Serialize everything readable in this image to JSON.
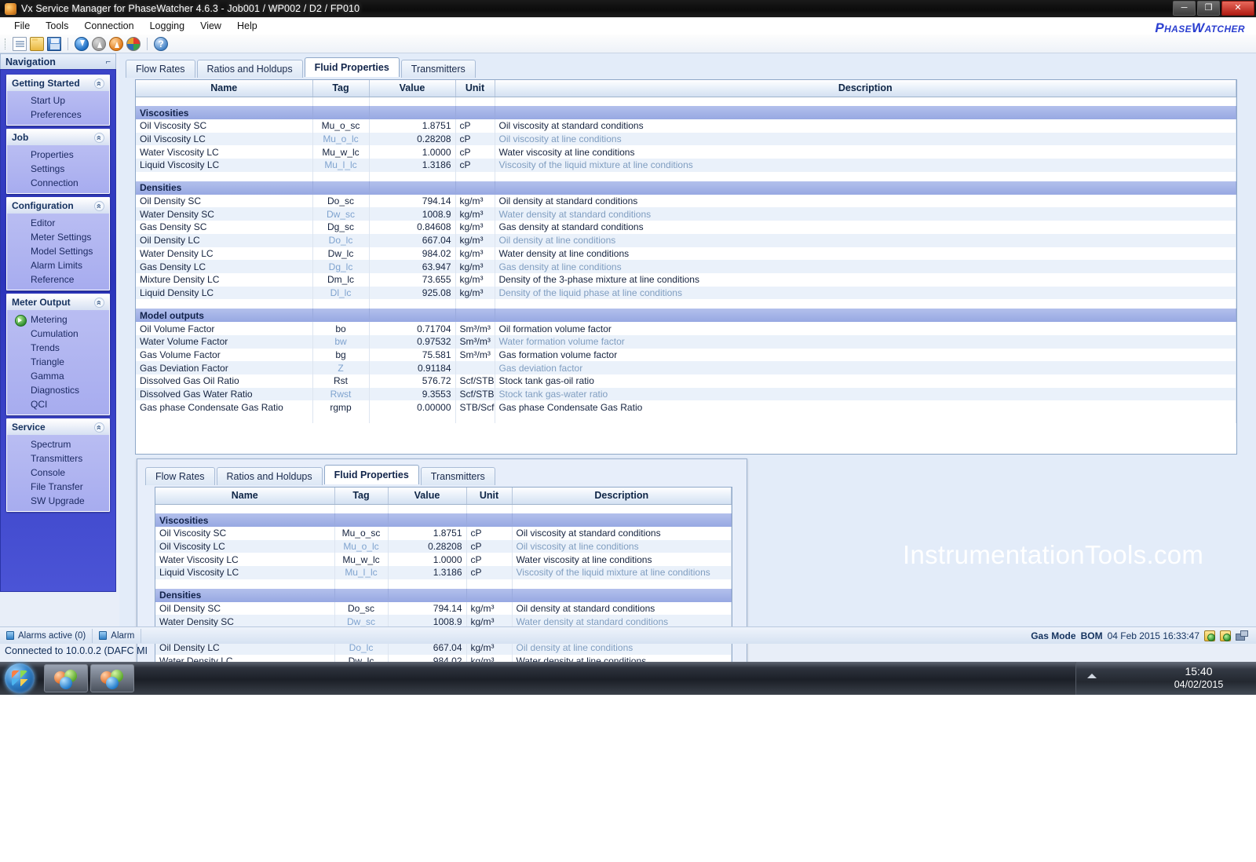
{
  "window": {
    "title": "Vx Service Manager for PhaseWatcher 4.6.3 - Job001 / WP002 / D2 / FP010",
    "icon": "app-icon",
    "minimize": "─",
    "maximize": "❐",
    "close": "✕",
    "brand": "PhaseWatcher"
  },
  "menu": {
    "items": [
      "File",
      "Tools",
      "Connection",
      "Logging",
      "View",
      "Help"
    ]
  },
  "toolbar": {
    "icons": [
      {
        "name": "new-document-icon",
        "cls": "ic-doc"
      },
      {
        "name": "open-folder-icon",
        "cls": "ic-folder"
      },
      {
        "name": "save-icon",
        "cls": "ic-save"
      },
      {
        "name": "download-icon",
        "cls": "ic-dl"
      },
      {
        "name": "upload-disabled-icon",
        "cls": "ic-ul1"
      },
      {
        "name": "upload-icon",
        "cls": "ic-ul2"
      },
      {
        "name": "refresh-icon",
        "cls": "ic-refresh"
      },
      {
        "name": "help-icon",
        "cls": "ic-help",
        "glyph": "?"
      }
    ]
  },
  "navigation": {
    "title": "Navigation",
    "pin_icon": "pin-icon",
    "collapse_icon": "chevron-up-icon",
    "groups": [
      {
        "title": "Getting Started",
        "items": [
          {
            "label": "Start Up"
          },
          {
            "label": "Preferences"
          }
        ]
      },
      {
        "title": "Job",
        "items": [
          {
            "label": "Properties"
          },
          {
            "label": "Settings"
          },
          {
            "label": "Connection"
          }
        ]
      },
      {
        "title": "Configuration",
        "items": [
          {
            "label": "Editor"
          },
          {
            "label": "Meter Settings"
          },
          {
            "label": "Model Settings"
          },
          {
            "label": "Alarm Limits"
          },
          {
            "label": "Reference"
          }
        ]
      },
      {
        "title": "Meter Output",
        "items": [
          {
            "label": "Metering",
            "active": true
          },
          {
            "label": "Cumulation"
          },
          {
            "label": "Trends"
          },
          {
            "label": "Triangle"
          },
          {
            "label": "Gamma"
          },
          {
            "label": "Diagnostics"
          },
          {
            "label": "QCI"
          }
        ]
      },
      {
        "title": "Service",
        "items": [
          {
            "label": "Spectrum"
          },
          {
            "label": "Transmitters"
          },
          {
            "label": "Console"
          },
          {
            "label": "File Transfer"
          },
          {
            "label": "SW Upgrade"
          }
        ]
      }
    ]
  },
  "tabs": {
    "items": [
      "Flow Rates",
      "Ratios and Holdups",
      "Fluid Properties",
      "Transmitters"
    ],
    "selected": "Fluid Properties"
  },
  "table": {
    "headers": [
      "Name",
      "Tag",
      "Value",
      "Unit",
      "Description"
    ],
    "rows": [
      {
        "type": "blank"
      },
      {
        "type": "section",
        "name": "Viscosities"
      },
      {
        "type": "data",
        "name": "Oil Viscosity SC",
        "tag": "Mu_o_sc",
        "value": "1.8751",
        "unit": "cP",
        "desc": "Oil viscosity at standard conditions"
      },
      {
        "type": "data",
        "name": "Oil Viscosity LC",
        "tag": "Mu_o_lc",
        "value": "0.28208",
        "unit": "cP",
        "desc": "Oil viscosity at line conditions"
      },
      {
        "type": "data",
        "name": "Water Viscosity LC",
        "tag": "Mu_w_lc",
        "value": "1.0000",
        "unit": "cP",
        "desc": "Water viscosity at line conditions"
      },
      {
        "type": "data",
        "name": "Liquid Viscosity LC",
        "tag": "Mu_l_lc",
        "value": "1.3186",
        "unit": "cP",
        "desc": "Viscosity of the liquid mixture at line conditions"
      },
      {
        "type": "blank"
      },
      {
        "type": "section",
        "name": "Densities"
      },
      {
        "type": "data",
        "name": "Oil Density SC",
        "tag": "Do_sc",
        "value": "794.14",
        "unit": "kg/m³",
        "desc": "Oil density at standard conditions"
      },
      {
        "type": "data",
        "name": "Water Density SC",
        "tag": "Dw_sc",
        "value": "1008.9",
        "unit": "kg/m³",
        "desc": "Water density at standard conditions"
      },
      {
        "type": "data",
        "name": "Gas Density SC",
        "tag": "Dg_sc",
        "value": "0.84608",
        "unit": "kg/m³",
        "desc": "Gas density at standard conditions"
      },
      {
        "type": "data",
        "name": "Oil Density LC",
        "tag": "Do_lc",
        "value": "667.04",
        "unit": "kg/m³",
        "desc": "Oil density at line conditions"
      },
      {
        "type": "data",
        "name": "Water Density LC",
        "tag": "Dw_lc",
        "value": "984.02",
        "unit": "kg/m³",
        "desc": "Water density at line conditions"
      },
      {
        "type": "data",
        "name": "Gas Density LC",
        "tag": "Dg_lc",
        "value": "63.947",
        "unit": "kg/m³",
        "desc": "Gas density at line conditions"
      },
      {
        "type": "data",
        "name": "Mixture Density LC",
        "tag": "Dm_lc",
        "value": "73.655",
        "unit": "kg/m³",
        "desc": "Density of the 3-phase mixture at line conditions"
      },
      {
        "type": "data",
        "name": "Liquid Density LC",
        "tag": "Dl_lc",
        "value": "925.08",
        "unit": "kg/m³",
        "desc": "Density of the liquid phase at line conditions"
      },
      {
        "type": "blank"
      },
      {
        "type": "section",
        "name": "Model outputs"
      },
      {
        "type": "data",
        "name": "Oil Volume Factor",
        "tag": "bo",
        "value": "0.71704",
        "unit": "Sm³/m³",
        "desc": "Oil formation volume factor"
      },
      {
        "type": "data",
        "name": "Water Volume Factor",
        "tag": "bw",
        "value": "0.97532",
        "unit": "Sm³/m³",
        "desc": "Water formation volume factor"
      },
      {
        "type": "data",
        "name": "Gas Volume Factor",
        "tag": "bg",
        "value": "75.581",
        "unit": "Sm³/m³",
        "desc": "Gas formation volume factor"
      },
      {
        "type": "data",
        "name": "Gas Deviation Factor",
        "tag": "Z",
        "value": "0.91184",
        "unit": "",
        "desc": "Gas deviation factor"
      },
      {
        "type": "data",
        "name": "Dissolved Gas Oil Ratio",
        "tag": "Rst",
        "value": "576.72",
        "unit": "Scf/STB",
        "desc": "Stock tank gas-oil ratio"
      },
      {
        "type": "data",
        "name": "Dissolved Gas Water Ratio",
        "tag": "Rwst",
        "value": "9.3553",
        "unit": "Scf/STB",
        "desc": "Stock tank gas-water ratio"
      },
      {
        "type": "data",
        "name": "Gas phase Condensate Gas Ratio",
        "tag": "rgmp",
        "value": "0.00000",
        "unit": "STB/Scf",
        "desc": "Gas phase Condensate Gas Ratio"
      },
      {
        "type": "blank"
      }
    ]
  },
  "statusbar": {
    "alarms_active": "Alarms active (0)",
    "alarms_second": "Alarm",
    "alarm_icon": "alarm-icon",
    "gas_mode_label": "Gas Mode",
    "gas_mode_value": "BOM",
    "timestamp": "04 Feb 2015 16:33:47",
    "connection": "Connected to 10.0.0.2 (DAFC MI"
  },
  "watermark": "InstrumentationTools.com",
  "taskbar": {
    "start_icon": "windows-start-icon",
    "apps": [
      {
        "name": "taskbar-app-vx-1"
      },
      {
        "name": "taskbar-app-vx-2"
      }
    ],
    "tray_expand_icon": "tray-expand-icon",
    "clock_time": "15:40",
    "clock_date": "04/02/2015"
  }
}
